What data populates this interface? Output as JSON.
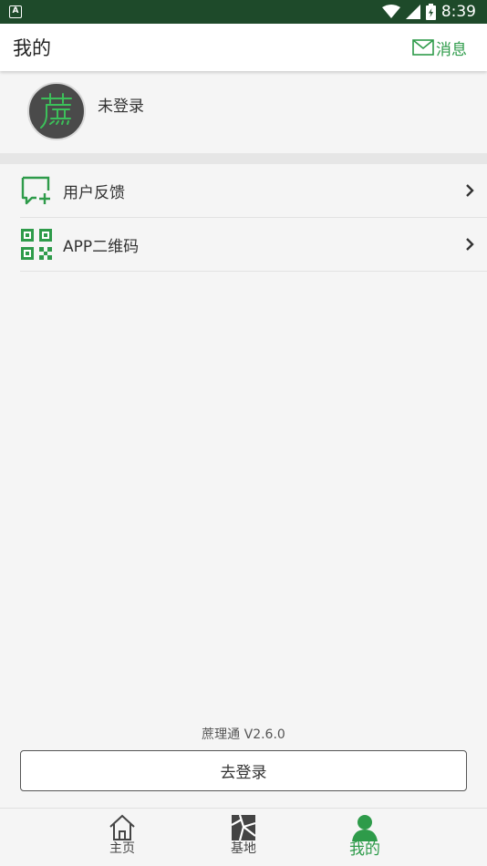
{
  "status_bar": {
    "notification_icon": "A",
    "time": "8:39",
    "icons": [
      "wifi-icon",
      "signal-icon",
      "battery-icon"
    ]
  },
  "app_bar": {
    "title": "我的",
    "message_label": "消息",
    "message_icon": "mail-icon"
  },
  "profile": {
    "avatar_char": "蔗",
    "status": "未登录"
  },
  "menu": {
    "items": [
      {
        "label": "用户反馈",
        "icon": "feedback-icon"
      },
      {
        "label": "APP二维码",
        "icon": "qr-code-icon"
      }
    ]
  },
  "version": "蔗理通 V2.6.0",
  "login_button": "去登录",
  "bottom_nav": {
    "items": [
      {
        "label": "主页",
        "icon": "home-icon",
        "active": false
      },
      {
        "label": "基地",
        "icon": "map-icon",
        "active": false
      },
      {
        "label": "我的",
        "icon": "user-icon",
        "active": true
      }
    ]
  },
  "colors": {
    "accent": "#2e9b4a",
    "status_bar": "#1e4a2a",
    "background": "#f5f5f5"
  }
}
